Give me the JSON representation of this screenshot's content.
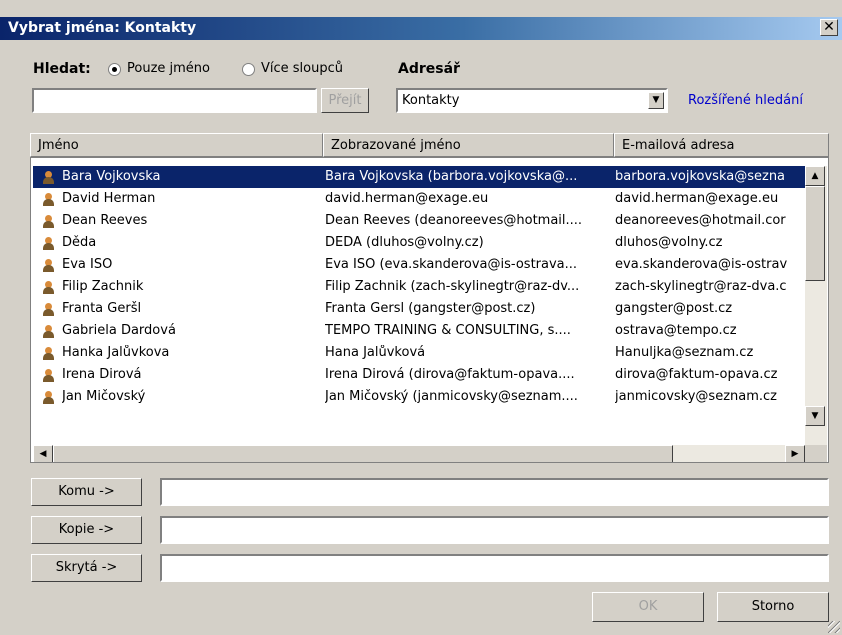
{
  "window": {
    "title": "Vybrat jména: Kontakty",
    "close": "✕"
  },
  "search": {
    "label": "Hledat:",
    "option_names": "Pouze jméno",
    "option_columns": "Více sloupců",
    "selected": "Pouze jméno",
    "value": "",
    "go_label": "Přejít"
  },
  "addressbook": {
    "label": "Adresář",
    "selected": "Kontakty",
    "advanced_link": "Rozšířené hledání"
  },
  "columns": [
    "Jméno",
    "Zobrazované jméno",
    "E-mailová adresa"
  ],
  "contacts": [
    {
      "name": "Bara Vojkovska",
      "display": "Bara Vojkovska (barbora.vojkovska@...",
      "email": "barbora.vojkovska@sezna",
      "selected": true
    },
    {
      "name": "David Herman",
      "display": "david.herman@exage.eu",
      "email": "david.herman@exage.eu"
    },
    {
      "name": "Dean Reeves",
      "display": "Dean Reeves (deanoreeves@hotmail....",
      "email": "deanoreeves@hotmail.cor"
    },
    {
      "name": "Děda",
      "display": "DEDA (dluhos@volny.cz)",
      "email": "dluhos@volny.cz"
    },
    {
      "name": "Eva ISO",
      "display": "Eva ISO (eva.skanderova@is-ostrava...",
      "email": "eva.skanderova@is-ostrav"
    },
    {
      "name": "Filip Zachnik",
      "display": "Filip Zachnik (zach-skylinegtr@raz-dv...",
      "email": "zach-skylinegtr@raz-dva.c"
    },
    {
      "name": "Franta Geršl",
      "display": "Franta Gersl (gangster@post.cz)",
      "email": "gangster@post.cz"
    },
    {
      "name": "Gabriela Dardová",
      "display": "TEMPO TRAINING & CONSULTING, s....",
      "email": "ostrava@tempo.cz"
    },
    {
      "name": "Hanka Jalůvkova",
      "display": "Hana Jalůvková",
      "email": "Hanuljka@seznam.cz"
    },
    {
      "name": "Irena Dirová",
      "display": "Irena Dirová (dirova@faktum-opava....",
      "email": "dirova@faktum-opava.cz"
    },
    {
      "name": "Jan Mičovský",
      "display": "Jan Mičovský (janmicovsky@seznam....",
      "email": "janmicovsky@seznam.cz"
    }
  ],
  "recipients": {
    "to_label": "Komu ->",
    "cc_label": "Kopie ->",
    "bcc_label": "Skrytá ->"
  },
  "buttons": {
    "ok": "OK",
    "cancel": "Storno"
  }
}
